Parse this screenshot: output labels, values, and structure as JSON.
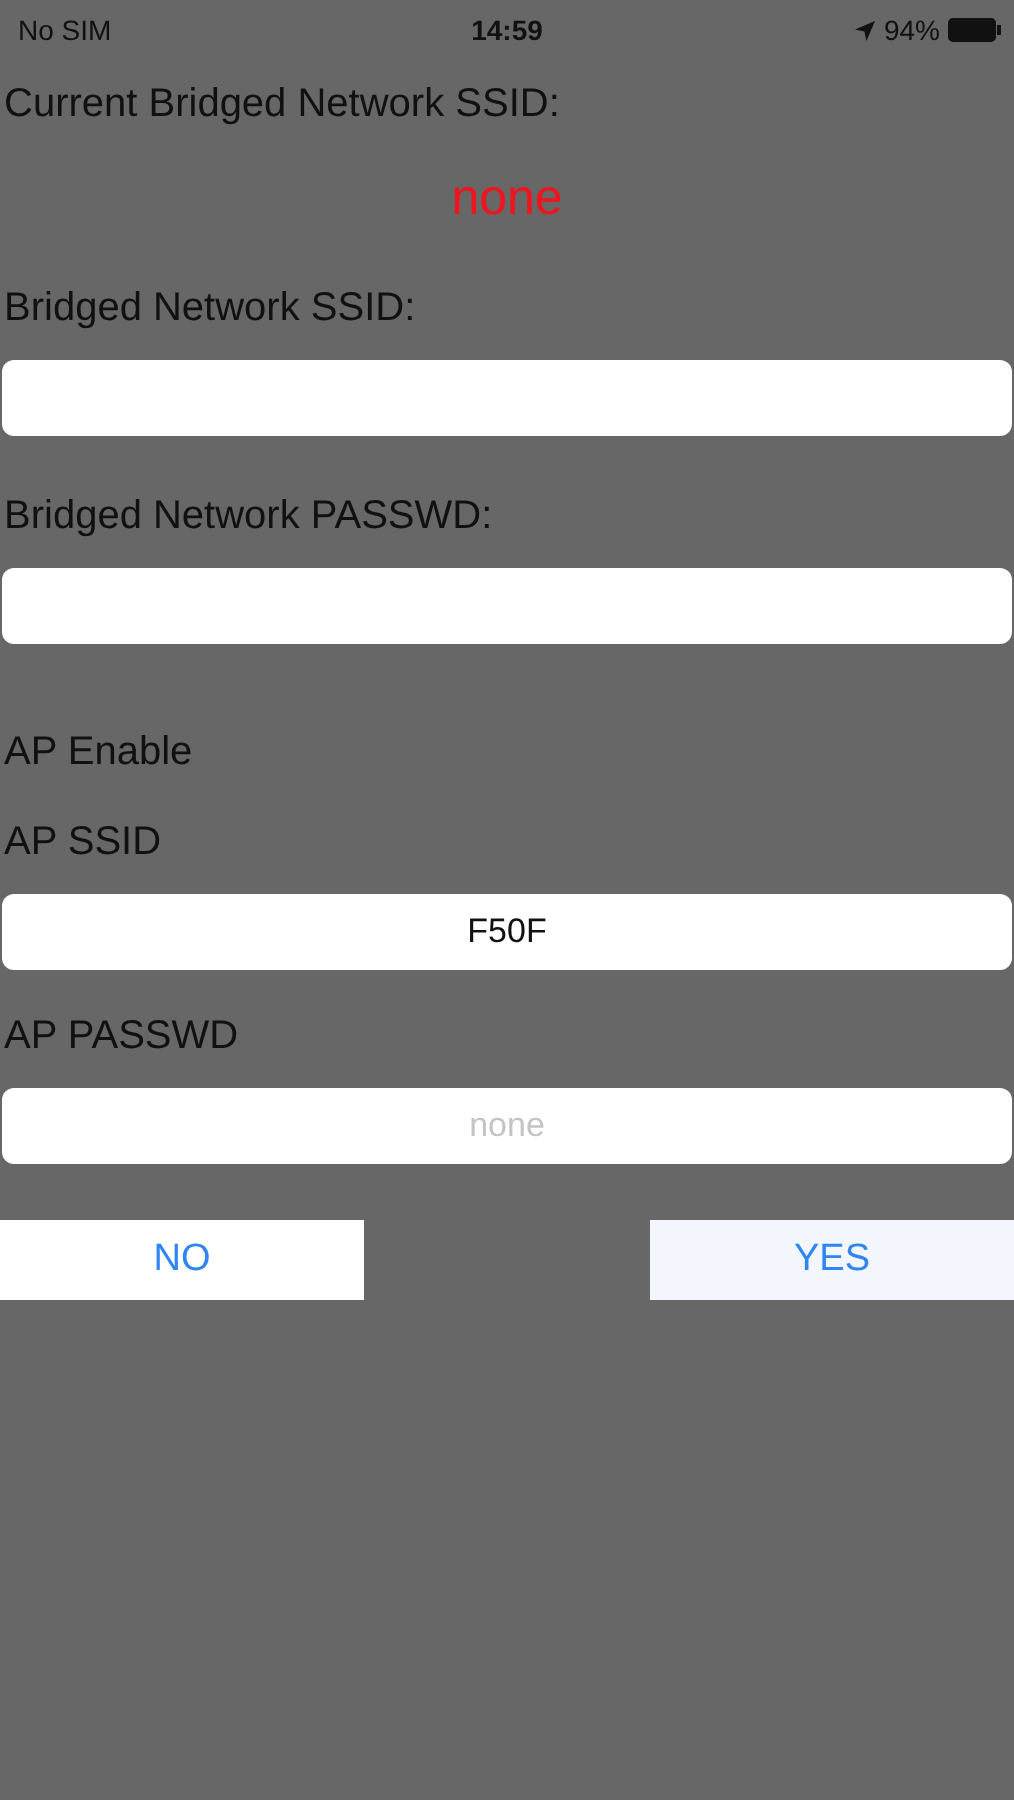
{
  "status_bar": {
    "carrier": "No SIM",
    "time": "14:59",
    "battery": "94%"
  },
  "current": {
    "label": "Current Bridged Network SSID:",
    "value": "none"
  },
  "fields": [
    {
      "label": "Bridged Network SSID:"
    },
    {
      "label": "Bridged Network PASSWD:"
    }
  ],
  "ap_enable": {
    "label": "AP Enable"
  },
  "ap_fields": [
    {
      "label": "AP SSID",
      "value": "F50F"
    },
    {
      "label": "AP PASSWD",
      "placeholder": "none"
    }
  ],
  "buttons": [
    {
      "label": "NO",
      "highlighted": false
    },
    {
      "label": "YES",
      "highlighted": true
    }
  ]
}
